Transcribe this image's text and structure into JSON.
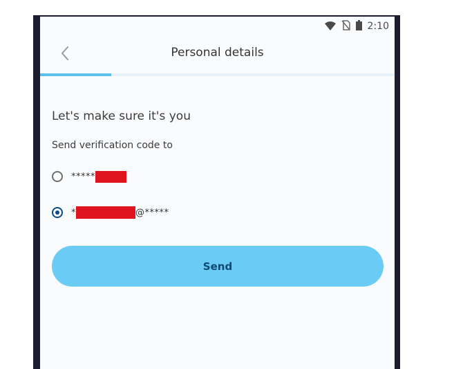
{
  "statusbar": {
    "time": "2:10",
    "icons": [
      "wifi-icon",
      "no-sim-icon",
      "battery-icon"
    ]
  },
  "header": {
    "title": "Personal details",
    "back_icon": "chevron-left-icon"
  },
  "progress": {
    "fraction": 0.2
  },
  "content": {
    "heading": "Let's make sure it's you",
    "subheading": "Send verification code to"
  },
  "options": [
    {
      "prefix": "*****",
      "suffix": "",
      "selected": false
    },
    {
      "prefix": "*",
      "suffix": "@*****",
      "selected": true
    }
  ],
  "send_button": {
    "label": "Send"
  },
  "colors": {
    "accent": "#6acbf4",
    "primary_text": "#0d4a74",
    "selected_radio": "#0a4b86",
    "redaction": "#e0141e"
  }
}
